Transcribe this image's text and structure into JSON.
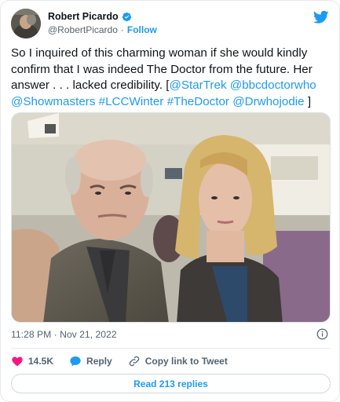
{
  "author": {
    "name": "Robert Picardo",
    "handle": "@RobertPicardo",
    "separator": "·",
    "follow_label": "Follow"
  },
  "tweet": {
    "text_plain": "So I inquired of this charming woman if she would kindly confirm that I was indeed The Doctor from the future. Her answer . . . lacked credibility. [",
    "links": [
      "@StarTrek",
      "@bbcdoctorwho",
      "@Showmasters",
      "#LCCWinter",
      "#TheDoctor",
      "@Drwhojodie"
    ],
    "text_end": " ]",
    "timestamp": "11:28 PM · Nov 21, 2022"
  },
  "actions": {
    "like_count": "14.5K",
    "reply_label": "Reply",
    "copy_label": "Copy link to Tweet"
  },
  "replies_button": "Read 213 replies",
  "colors": {
    "accent": "#1d9bf0",
    "like": "#f91880",
    "text": "#0f1419",
    "muted": "#536471"
  },
  "icons": [
    "twitter-bird-icon",
    "verified-badge-icon",
    "info-icon",
    "heart-icon",
    "reply-bubble-icon",
    "link-icon"
  ]
}
